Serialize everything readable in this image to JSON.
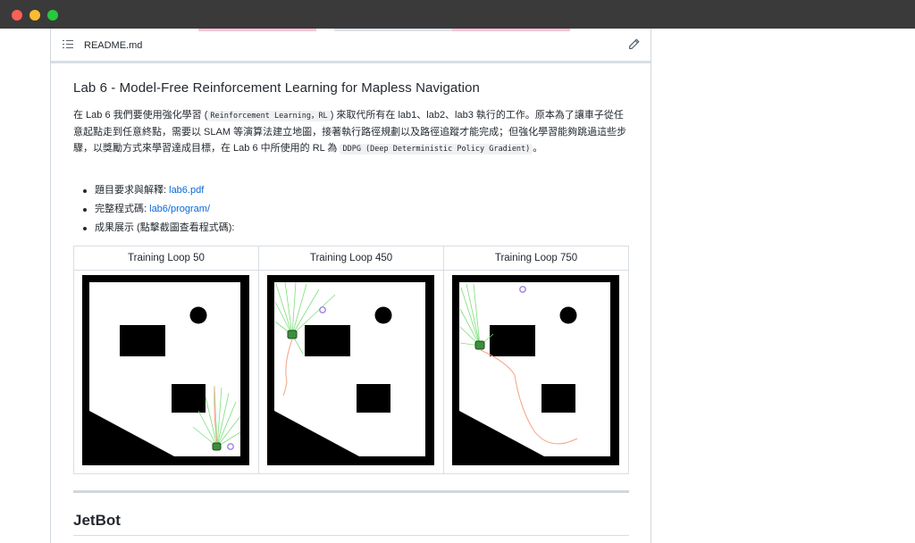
{
  "window": {
    "controls": [
      "close",
      "minimize",
      "maximize"
    ]
  },
  "file_header": {
    "filename": "README.md",
    "list_icon": "list-icon",
    "edit_icon": "pencil-icon"
  },
  "section": {
    "heading": "Lab 6 - Model-Free Reinforcement Learning for Mapless Navigation",
    "paragraph": {
      "part1": "在 Lab 6 我們要使用強化學習 (",
      "code1": "Reinforcement Learning，RL",
      "part2": ") 來取代所有在 lab1、lab2、lab3 執行的工作。原本為了讓車子從任意起點走到任意終點，需要以 SLAM 等演算法建立地圖，接著執行路徑規劃以及路徑追蹤才能完成；但強化學習能夠跳過這些步驟，以獎勵方式來學習達成目標，在 Lab 6 中所使用的 RL 為 ",
      "code2": "DDPG (Deep Deterministic Policy Gradient)",
      "part3": "。"
    },
    "list": [
      {
        "label": "題目要求與解釋: ",
        "link": "lab6.pdf"
      },
      {
        "label": "完整程式碼: ",
        "link": "lab6/program/"
      },
      {
        "label": "成果展示 (點擊截圖查看程式碼):"
      }
    ],
    "table": {
      "headers": [
        "Training Loop 50",
        "Training Loop 450",
        "Training Loop 750"
      ]
    }
  },
  "next_section": {
    "heading": "JetBot"
  },
  "colors": {
    "titlebar": "#3a3a3a",
    "link": "#0969da",
    "lidar": "#7be07b",
    "path": "#f4a484",
    "goal": "#a27ee8"
  }
}
